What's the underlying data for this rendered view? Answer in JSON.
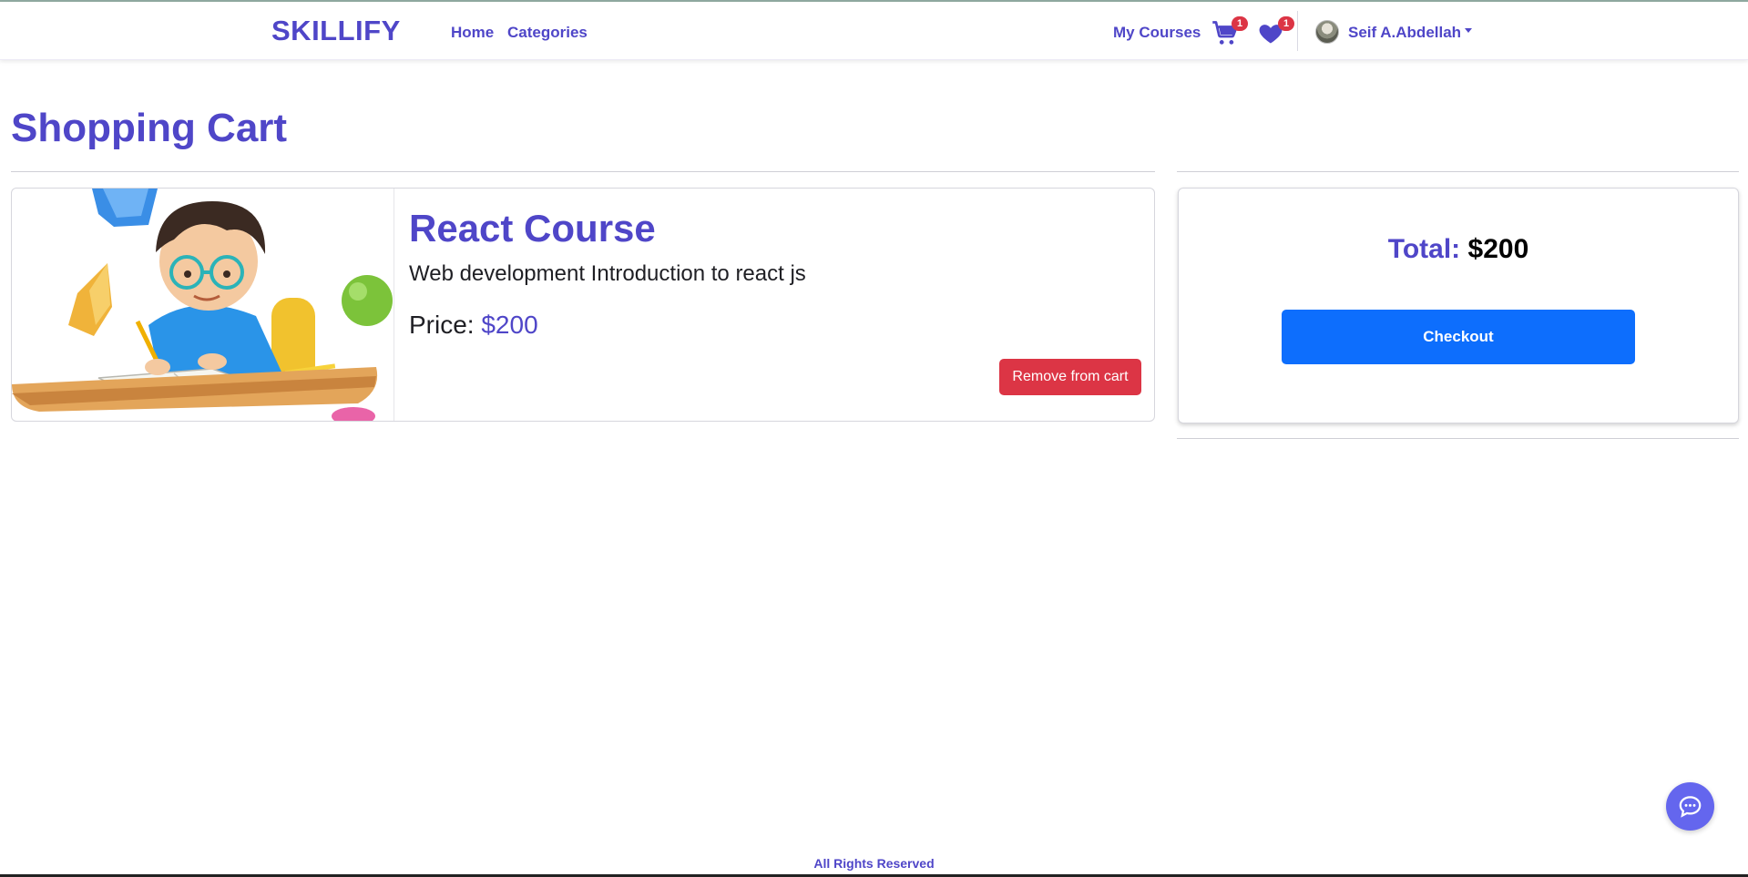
{
  "navbar": {
    "brand": "SKILLIFY",
    "links": {
      "home": "Home",
      "categories": "Categories",
      "my_courses": "My Courses"
    },
    "cart_badge": "1",
    "wishlist_badge": "1",
    "user_name": "Seif A.Abdellah",
    "icons": {
      "cart": "cart-icon",
      "wishlist": "heart-icon",
      "avatar": "avatar"
    }
  },
  "page": {
    "title": "Shopping Cart"
  },
  "cart_items": [
    {
      "title": "React Course",
      "description": "Web development Introduction to react js",
      "price_label": "Price:",
      "price_value": "$200",
      "remove_label": "Remove from cart"
    }
  ],
  "summary": {
    "total_label": "Total:",
    "total_value": "$200",
    "checkout_label": "Checkout"
  },
  "footer": {
    "text": "All Rights Reserved"
  },
  "colors": {
    "brand": "#4f46c8",
    "danger": "#dc3545",
    "primary": "#0d6efd",
    "chat": "#6466ee"
  }
}
